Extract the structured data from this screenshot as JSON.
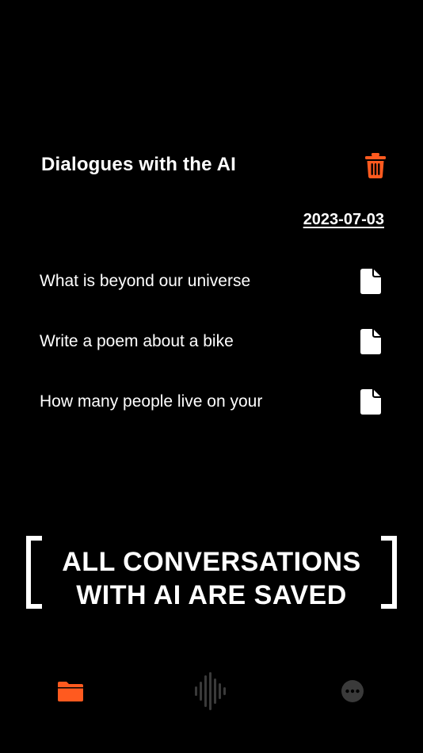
{
  "header": {
    "title": "Dialogues with the AI",
    "delete_icon": "trash-icon"
  },
  "date_label": "2023-07-03",
  "conversations": [
    {
      "text": "What is beyond our universe",
      "icon": "document-icon"
    },
    {
      "text": "Write a poem about a bike",
      "icon": "document-icon"
    },
    {
      "text": "How many people live on your",
      "icon": "document-icon"
    }
  ],
  "promo": {
    "line1": "ALL CONVERSATIONS",
    "line2": "WITH AI ARE SAVED"
  },
  "tabbar": {
    "tabs": [
      {
        "icon": "folder-icon",
        "active": true
      },
      {
        "icon": "waveform-icon",
        "active": false
      },
      {
        "icon": "more-icon",
        "active": false
      }
    ]
  },
  "colors": {
    "background": "#000000",
    "accent": "#FF5A1F",
    "text": "#FFFFFF",
    "inactive_icon": "#3A3A3A"
  }
}
